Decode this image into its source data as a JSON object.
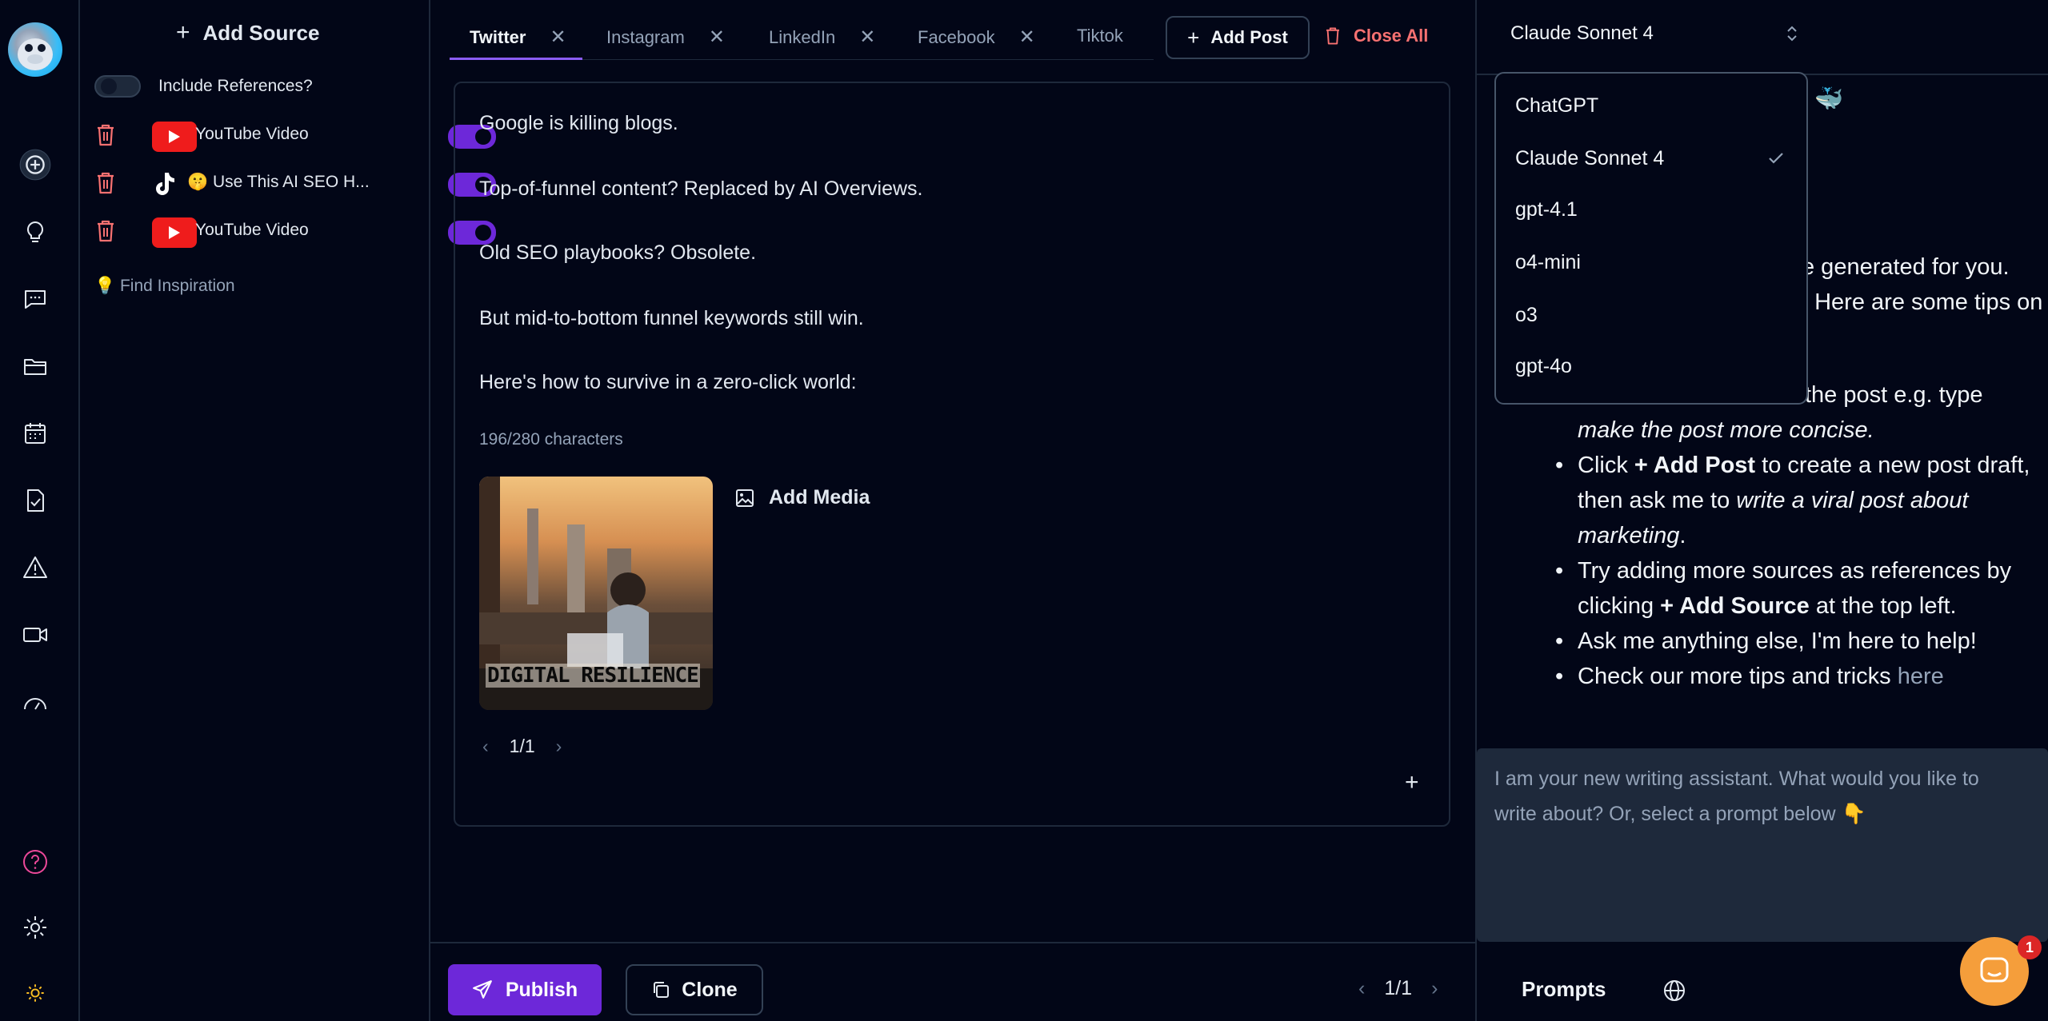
{
  "rail": {
    "icons": [
      "add-circle-icon",
      "lightbulb-icon",
      "chat-icon",
      "folder-icon",
      "calendar-icon",
      "document-check-icon",
      "alert-icon",
      "video-icon",
      "gauge-icon",
      "help-icon",
      "gear-icon",
      "sun-icon"
    ]
  },
  "sources": {
    "add_source_label": "Add Source",
    "include_refs_label": "Include References?",
    "include_refs_on": false,
    "items": [
      {
        "type": "youtube",
        "label": "YouTube Video",
        "enabled": true
      },
      {
        "type": "tiktok",
        "label": "🤫 Use This AI SEO H...",
        "enabled": true
      },
      {
        "type": "youtube",
        "label": "YouTube Video",
        "enabled": true
      }
    ],
    "find_inspiration_label": "💡 Find Inspiration"
  },
  "editor": {
    "tabs": [
      {
        "label": "Twitter",
        "active": true,
        "closable": true
      },
      {
        "label": "Instagram",
        "active": false,
        "closable": true
      },
      {
        "label": "LinkedIn",
        "active": false,
        "closable": true
      },
      {
        "label": "Facebook",
        "active": false,
        "closable": true
      },
      {
        "label": "Tiktok",
        "active": false,
        "closable": false
      }
    ],
    "add_post_label": "Add Post",
    "close_all_label": "Close All",
    "post_lines": [
      "Google is killing blogs.",
      "Top-of-funnel content? Replaced by AI Overviews.",
      "Old SEO playbooks? Obsolete.",
      "But mid-to-bottom funnel keywords still win.",
      "Here's how to survive in a zero-click world:"
    ],
    "char_count": "196/280 characters",
    "media_caption": "DIGITAL RESILIENCE",
    "add_media_label": "Add Media",
    "media_pager": "1/1",
    "publish_label": "Publish",
    "clone_label": "Clone",
    "post_pager": "1/1"
  },
  "assistant": {
    "selected_model": "Claude Sonnet 4",
    "models": [
      "ChatGPT",
      "Claude Sonnet 4",
      "gpt-4.1",
      "o4-mini",
      "o3",
      "gpt-4o"
    ],
    "partial_lines": {
      "l1": "... 🐳",
      "l2": "e generated for you.",
      "l3": ". Here are some tips on",
      "l4": "the post e.g. type"
    },
    "tip1_italic": "make the post more concise.",
    "tip2": {
      "pre": "Click ",
      "bold": "+ Add Post",
      "mid": " to create a new post draft, then ask me to ",
      "italic": "write a viral post about marketing",
      "post": "."
    },
    "tip3": {
      "pre": "Try adding more sources as references by clicking ",
      "bold": "+ Add Source",
      "post": " at the top left."
    },
    "tip4": "Ask me anything else, I'm here to help!",
    "tip5": {
      "pre": "Check our more tips and tricks ",
      "link": "here"
    },
    "chat_placeholder": "I am your new writing assistant. What would you like to write about? Or, select a prompt below 👇",
    "prompts_label": "Prompts",
    "notification_count": "1"
  },
  "colors": {
    "accent": "#6d28d9",
    "danger": "#f87171",
    "youtube": "#ef1c1c",
    "bg": "#020617",
    "border": "#1e293b"
  }
}
